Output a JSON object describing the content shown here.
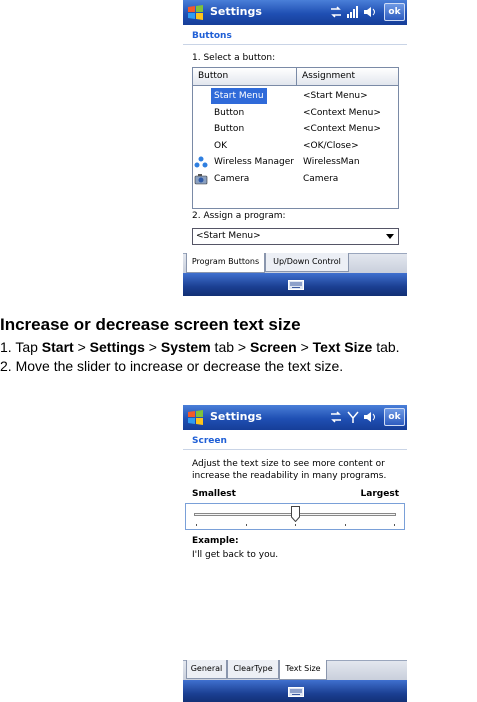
{
  "screen1": {
    "title": "Settings",
    "ok": "ok",
    "section": "Buttons",
    "step1": "1. Select a button:",
    "columns": [
      "Button",
      "Assignment"
    ],
    "rows": [
      {
        "button": "Start Menu",
        "assignment": "<Start Menu>",
        "icon": "",
        "selected": true
      },
      {
        "button": "Button",
        "assignment": "<Context Menu>",
        "icon": "",
        "selected": false
      },
      {
        "button": "Button",
        "assignment": "<Context Menu>",
        "icon": "",
        "selected": false
      },
      {
        "button": "OK",
        "assignment": "<OK/Close>",
        "icon": "",
        "selected": false
      },
      {
        "button": "Wireless Manager",
        "assignment": "WirelessMan",
        "icon": "wireless-manager-icon",
        "selected": false
      },
      {
        "button": "Camera",
        "assignment": "Camera",
        "icon": "camera-icon",
        "selected": false
      }
    ],
    "step2": "2. Assign a program:",
    "program": "<Start Menu>",
    "tabs": [
      "Program Buttons",
      "Up/Down Control"
    ]
  },
  "doc": {
    "heading": "Increase or decrease screen text size",
    "step1": {
      "n": "1. Tap ",
      "a": "Start",
      "s1": " > ",
      "b": "Settings",
      "s2": " > ",
      "c": "System",
      "s3": " tab > ",
      "d": "Screen",
      "s4": " > ",
      "e": "Text Size",
      "s5": " tab."
    },
    "step2": "2. Move the slider to increase or decrease the text size."
  },
  "screen2": {
    "title": "Settings",
    "ok": "ok",
    "section": "Screen",
    "desc1": "Adjust the text size to see more content or",
    "desc2": "increase the readability in many programs.",
    "smallest": "Smallest",
    "largest": "Largest",
    "slider_level": 2,
    "slider_steps": 5,
    "example_label": "Example:",
    "example_text": "I'll get back to you.",
    "tabs": [
      "General",
      "ClearType",
      "Text Size"
    ]
  },
  "colors": {
    "titlebar": "#1f4fb3",
    "selection": "#2f6ad9",
    "section": "#1f5fd6"
  }
}
